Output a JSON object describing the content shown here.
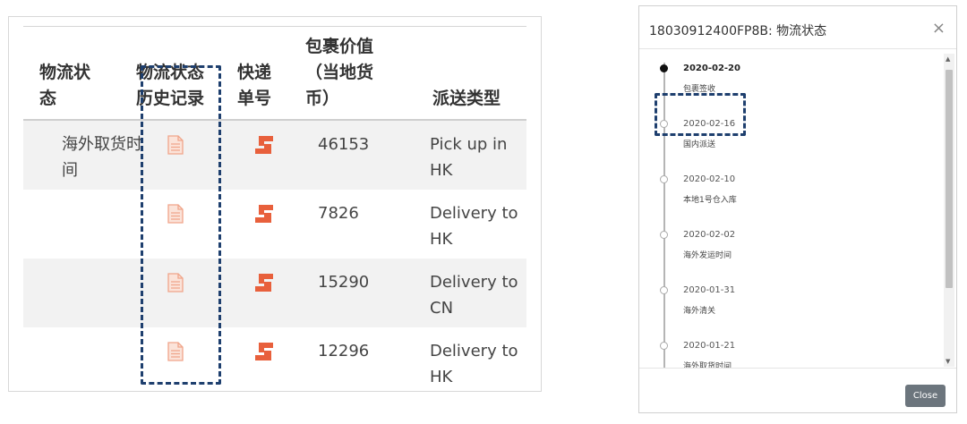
{
  "table": {
    "headers": {
      "status": "物流状\n态",
      "history": "物流状态\n历史记录",
      "tracking": "快递\n单号",
      "value": "包裹价值\n（当地货\n币）",
      "delivery_type": "派送类型"
    },
    "rows": [
      {
        "status": "海外取货时间",
        "amount": "46153",
        "delivery": "Pick up in\nHK"
      },
      {
        "status": "",
        "amount": "7826",
        "delivery": "Delivery to\nHK"
      },
      {
        "status": "",
        "amount": "15290",
        "delivery": "Delivery to\nCN"
      },
      {
        "status": "",
        "amount": "12296",
        "delivery": "Delivery to\nHK"
      }
    ],
    "icons": {
      "history": "document-icon",
      "tracking": "courier-icon"
    },
    "colors": {
      "icon": "#e8603c",
      "doc_icon": "#f0a58a",
      "highlight": "#1e3f6e",
      "alt_row": "#f2f2f2"
    }
  },
  "modal": {
    "title": "18030912400FP8B: 物流状态",
    "close_symbol": "×",
    "close_button": "Close",
    "timeline": [
      {
        "date": "2020-02-20",
        "desc": "包裹签收",
        "current": true
      },
      {
        "date": "2020-02-16",
        "desc": "国内派送"
      },
      {
        "date": "2020-02-10",
        "desc": "本地1号仓入库"
      },
      {
        "date": "2020-02-02",
        "desc": "海外发运时间"
      },
      {
        "date": "2020-01-31",
        "desc": "海外清关"
      },
      {
        "date": "2020-01-21",
        "desc": "海外取货时间"
      }
    ],
    "scrollbar": {
      "up": "▲",
      "down": "▼"
    }
  }
}
